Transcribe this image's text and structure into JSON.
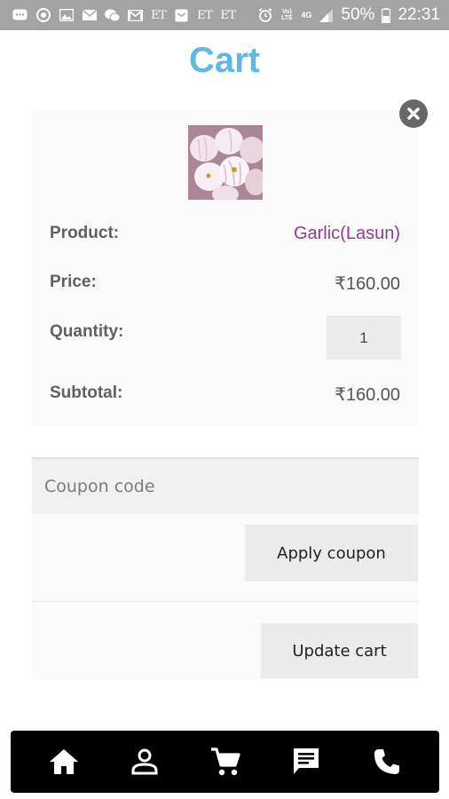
{
  "status_bar": {
    "carrier_text_1": "ET",
    "carrier_text_2": "ET",
    "carrier_text_3": "ET",
    "network_label": "4G",
    "volte_label": "Vo) LTE",
    "battery_percent": "50%",
    "time": "22:31"
  },
  "page": {
    "title": "Cart"
  },
  "cart_item": {
    "product_label": "Product:",
    "product_name": "Garlic(Lasun)",
    "price_label": "Price:",
    "price": "₹160.00",
    "quantity_label": "Quantity:",
    "quantity": "1",
    "subtotal_label": "Subtotal:",
    "subtotal": "₹160.00",
    "image_alt": "garlic-photo"
  },
  "coupon": {
    "placeholder": "Coupon code",
    "apply_label": "Apply coupon",
    "update_label": "Update cart"
  },
  "bottom_nav": {
    "items": [
      {
        "icon": "home-icon"
      },
      {
        "icon": "account-icon"
      },
      {
        "icon": "cart-icon"
      },
      {
        "icon": "chat-icon"
      },
      {
        "icon": "phone-icon"
      }
    ]
  },
  "colors": {
    "title": "#60b7e3",
    "product_link": "#8c3f8c",
    "status_bar": "#a3a3a3",
    "nav_bar": "#000000"
  }
}
